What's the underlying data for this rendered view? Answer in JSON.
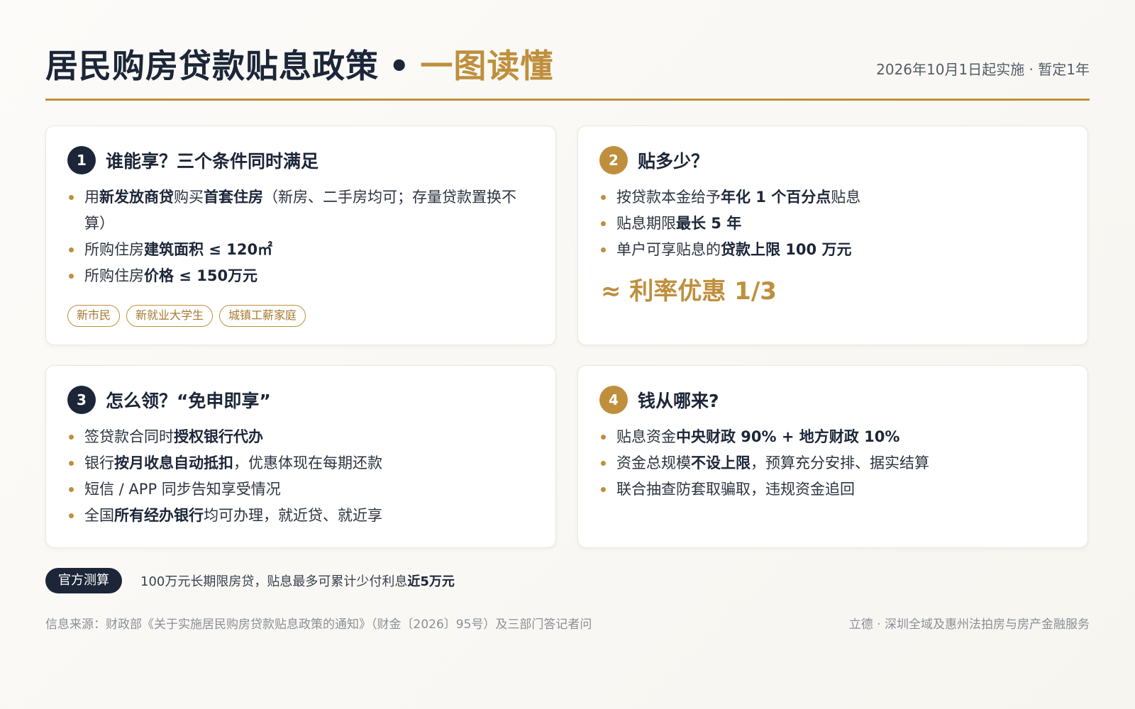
{
  "header": {
    "title_main": "居民购房贷款贴息政策",
    "title_dot": "•",
    "title_accent": "一图读懂",
    "meta": "2026年10月1日起实施 · 暂定1年"
  },
  "cards": [
    {
      "number": "1",
      "title": "谁能享？三个条件同时满足",
      "items": [
        {
          "t1": "用",
          "b1": "新发放商贷",
          "t2": "购买",
          "b2": "首套住房",
          "t3": "（新房、二手房均可；存量贷款置换不算）"
        },
        {
          "t1": "所购住房",
          "b1": "建筑面积 ≤ 120㎡"
        },
        {
          "t1": "所购住房",
          "b1": "价格 ≤ 150万元"
        }
      ],
      "tags": [
        "新市民",
        "新就业大学生",
        "城镇工薪家庭"
      ]
    },
    {
      "number": "2",
      "title": "贴多少？",
      "items": [
        {
          "t1": "按贷款本金给予",
          "b1": "年化 1 个百分点",
          "t2": "贴息"
        },
        {
          "t1": "贴息期限",
          "b1": "最长 5 年"
        },
        {
          "t1": "单户可享贴息的",
          "b1": "贷款上限 100 万元"
        }
      ],
      "highlight": "≈ 利率优惠 1/3"
    },
    {
      "number": "3",
      "title": "怎么领？“免申即享”",
      "items": [
        {
          "t1": "签贷款合同时",
          "b1": "授权银行代办"
        },
        {
          "t1": "银行",
          "b1": "按月收息自动抵扣",
          "t2": "，优惠体现在每期还款"
        },
        {
          "t1": "短信 / APP 同步告知享受情况"
        },
        {
          "t1": "全国",
          "b1": "所有经办银行",
          "t2": "均可办理，就近贷、就近享"
        }
      ]
    },
    {
      "number": "4",
      "title": "钱从哪来?",
      "items": [
        {
          "t1": "贴息资金",
          "b1": "中央财政 90% + 地方财政 10%"
        },
        {
          "t1": "资金总规模",
          "b1": "不设上限",
          "t2": "，预算充分安排、据实结算"
        },
        {
          "t1": "联合抽查防套取骗取，违规资金追回"
        }
      ]
    }
  ],
  "calc": {
    "badge": "官方测算",
    "text": "100万元长期限房贷，贴息最多可累计少付利息",
    "bold": "近5万元"
  },
  "footer": {
    "source": "信息来源：财政部《关于实施居民购房贷款贴息政策的通知》（财金〔2026〕95号）及三部门答记者问",
    "brand": "立德 · 深圳全域及惠州法拍房与房产金融服务"
  },
  "colors": {
    "navy": "#1c2638",
    "gold": "#bf8f3d",
    "card_bg": "#ffffff",
    "page_bg": "#f9f7f3"
  }
}
